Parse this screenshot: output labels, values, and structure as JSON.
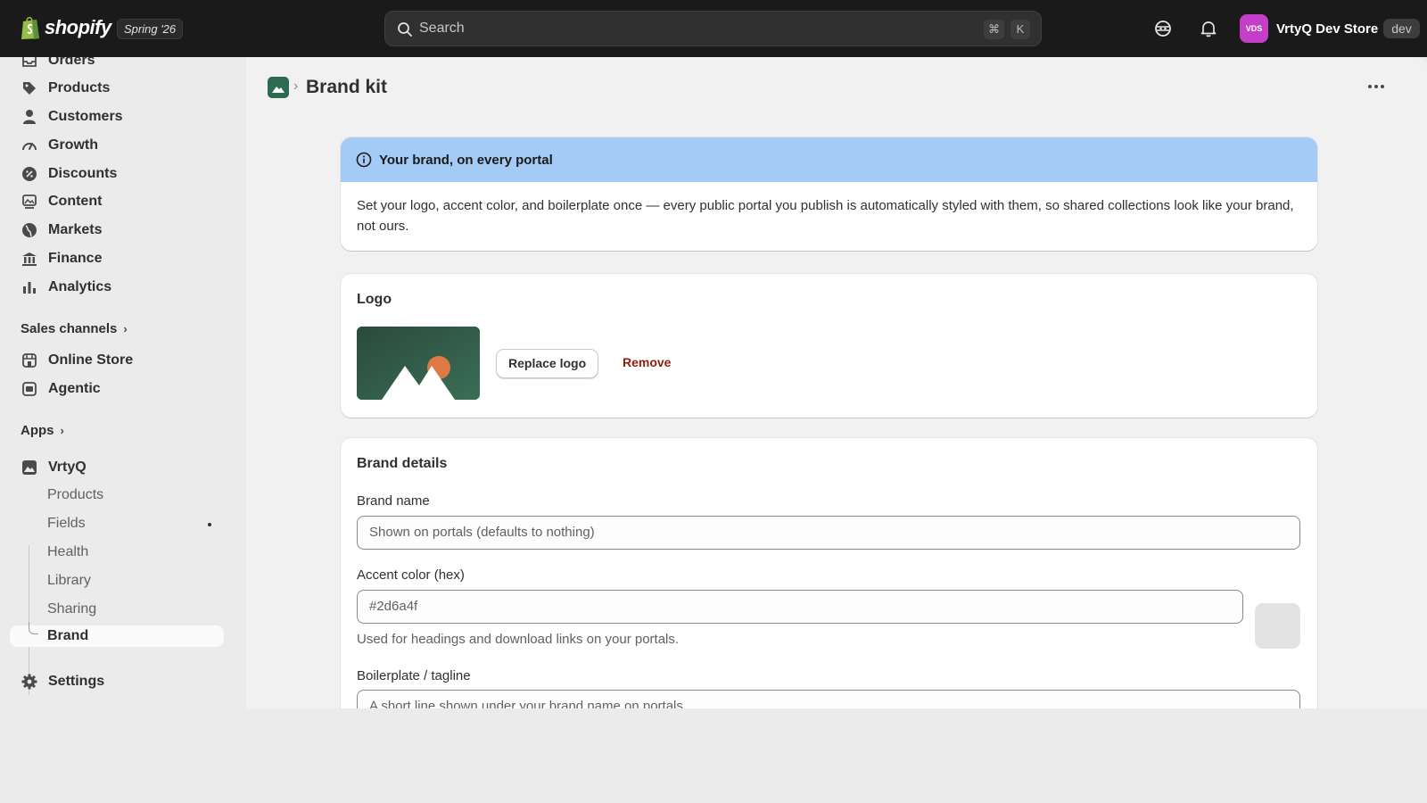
{
  "topbar": {
    "brand": "shopify",
    "version": "Spring '26",
    "search_placeholder": "Search",
    "shortcut_cmd": "⌘",
    "shortcut_key": "K",
    "store_initials": "VDS",
    "store_name": "VrtyQ Dev Store",
    "store_badge": "dev",
    "avatar_color": "#c43fc7"
  },
  "sidebar": {
    "items": [
      {
        "label": "Orders",
        "icon": "inbox-icon"
      },
      {
        "label": "Products",
        "icon": "tag-icon"
      },
      {
        "label": "Customers",
        "icon": "person-icon"
      },
      {
        "label": "Growth",
        "icon": "gauge-icon"
      },
      {
        "label": "Discounts",
        "icon": "discount-icon"
      },
      {
        "label": "Content",
        "icon": "image-icon"
      },
      {
        "label": "Markets",
        "icon": "globe-icon"
      },
      {
        "label": "Finance",
        "icon": "bank-icon"
      },
      {
        "label": "Analytics",
        "icon": "bar-chart-icon"
      }
    ],
    "sales_channels_label": "Sales channels",
    "channels": [
      {
        "label": "Online Store",
        "icon": "store-icon"
      },
      {
        "label": "Agentic",
        "icon": "agent-icon"
      }
    ],
    "apps_label": "Apps",
    "app": {
      "label": "VrtyQ",
      "subitems": [
        "Products",
        "Fields",
        "Health",
        "Library",
        "Sharing"
      ],
      "active_subitem": "Brand"
    },
    "settings_label": "Settings"
  },
  "page": {
    "title": "Brand kit",
    "banner": {
      "title": "Your brand, on every portal",
      "body": "Set your logo, accent color, and boilerplate once — every public portal you publish is automatically styled with them, so shared collections look like your brand, not ours."
    },
    "logo_card": {
      "title": "Logo",
      "replace_label": "Replace logo",
      "remove_label": "Remove"
    },
    "details_card": {
      "title": "Brand details",
      "brand_name_label": "Brand name",
      "brand_name_placeholder": "Shown on portals (defaults to nothing)",
      "accent_label": "Accent color (hex)",
      "accent_value": "#2d6a4f",
      "accent_help": "Used for headings and download links on your portals.",
      "boilerplate_label": "Boilerplate / tagline",
      "boilerplate_placeholder": "A short line shown under your brand name on portals."
    }
  }
}
